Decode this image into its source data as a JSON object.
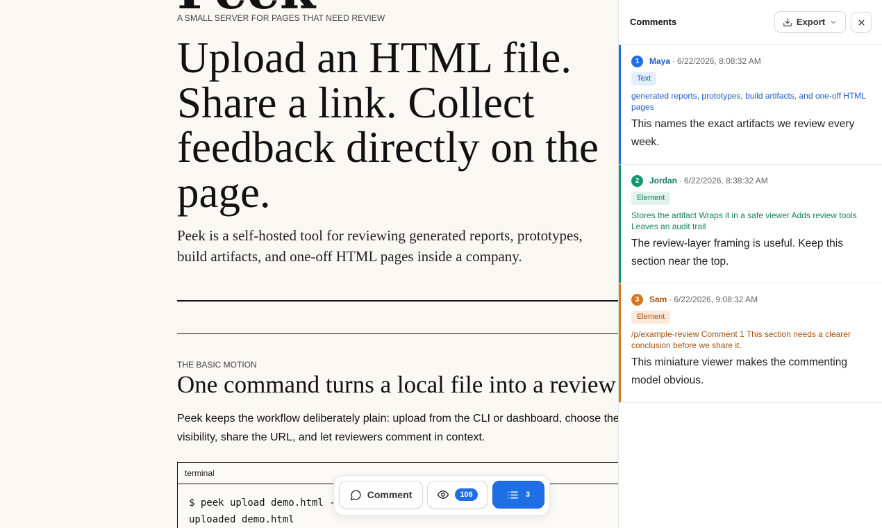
{
  "hero": {
    "title": "Peek",
    "kicker": "A SMALL SERVER FOR PAGES THAT NEED REVIEW",
    "headline": "Upload an HTML file. Share a link. Collect feedback directly on the page.",
    "lede": "Peek is a self-hosted tool for reviewing generated reports, prototypes, build artifacts, and one-off HTML pages inside a company."
  },
  "section": {
    "kicker": "THE BASIC MOTION",
    "title": "One command turns a local file into a review link.",
    "body": "Peek keeps the workflow deliberately plain: upload from the CLI or dashboard, choose the visibility, share the URL, and let reviewers comment in context."
  },
  "terminal": {
    "label": "terminal",
    "lines": [
      "$ peek upload demo.html --",
      "uploaded demo.html"
    ]
  },
  "toolbar": {
    "comment_label": "Comment",
    "views_count": "106",
    "comments_count": "3"
  },
  "sidebar": {
    "title": "Comments",
    "export_label": "Export",
    "comments": [
      {
        "number": "1",
        "author": "Maya",
        "timestamp": "6/22/2026, 8:08:32 AM",
        "tag": "Text",
        "quote": "generated reports, prototypes, build artifacts, and one-off HTML pages",
        "body": "This names the exact artifacts we review every week.",
        "color": "#1e6fe6"
      },
      {
        "number": "2",
        "author": "Jordan",
        "timestamp": "6/22/2026, 8:38:32 AM",
        "tag": "Element",
        "quote": "Stores the artifact Wraps it in a safe viewer Adds review tools Leaves an audit trail",
        "body": "The review-layer framing is useful. Keep this section near the top.",
        "color": "#13966e"
      },
      {
        "number": "3",
        "author": "Sam",
        "timestamp": "6/22/2026, 9:08:32 AM",
        "tag": "Element",
        "quote": "/p/example-review Comment 1 This section needs a clearer conclusion before we share it.",
        "body": "This miniature viewer makes the commenting model obvious.",
        "color": "#d9771a"
      }
    ]
  }
}
